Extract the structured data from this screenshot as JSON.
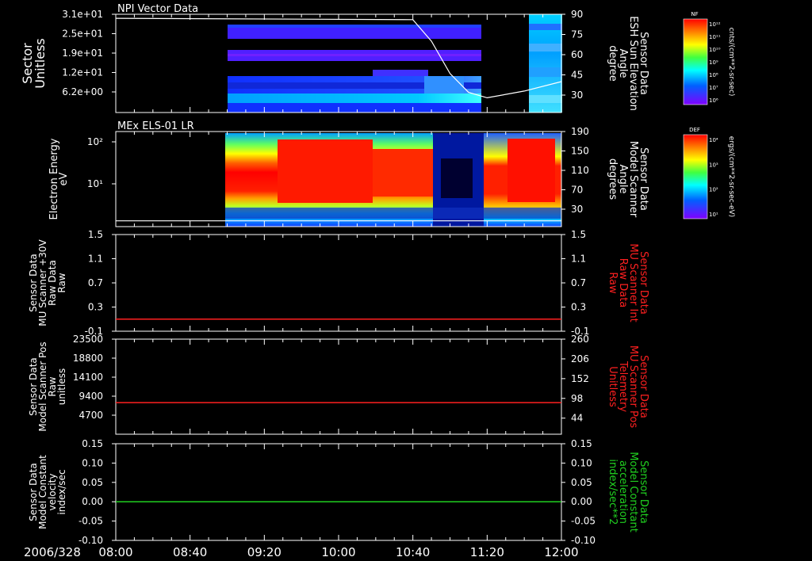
{
  "date_label": "2006/328",
  "time_ticks": [
    "08:00",
    "08:40",
    "09:20",
    "10:00",
    "10:40",
    "11:20",
    "12:00"
  ],
  "colors": {
    "axis": "#ffffff",
    "red_trace": "#ff2020",
    "green_trace": "#20d020"
  },
  "colorbars": [
    {
      "tag": "NF",
      "top_label": "10¹²",
      "bottom_label": "10⁶",
      "units": "cnts/(cm**2-sr-sec)",
      "tick_labels": [
        "10¹²",
        "10¹¹",
        "10¹⁰",
        "10⁹",
        "10⁸",
        "10⁷",
        "10⁶"
      ]
    },
    {
      "tag": "DEF",
      "top_label": "10⁴",
      "bottom_label": "10¹",
      "units": "ergs/(cm**2-sr-sec-eV)",
      "tick_labels": [
        "10⁴",
        "10³",
        "10²",
        "10¹"
      ]
    }
  ],
  "chart_data": [
    {
      "type": "heatmap",
      "title": "NPI Vector Data",
      "ylabel": [
        "Sector",
        "Unitless"
      ],
      "y_ticks": [
        "3.1e+01",
        "2.5e+01",
        "1.9e+01",
        "1.2e+01",
        "6.2e+00"
      ],
      "right_ylabel": [
        "Sensor Data",
        "ESH Sun Elevation",
        "Angle",
        "degree"
      ],
      "right_ticks": [
        "90",
        "75",
        "60",
        "45",
        "30"
      ],
      "overlay_line": {
        "name": "ESH Sun Elevation Angle",
        "color": "#ffffff",
        "points": [
          [
            "08:00",
            87
          ],
          [
            "10:40",
            86
          ],
          [
            "10:50",
            70
          ],
          [
            "11:00",
            46
          ],
          [
            "11:10",
            32
          ],
          [
            "11:20",
            28
          ],
          [
            "11:40",
            33
          ],
          [
            "12:00",
            40
          ]
        ]
      }
    },
    {
      "type": "heatmap",
      "title": "MEx ELS-01 LR",
      "ylabel": [
        "Electron Energy",
        "eV"
      ],
      "y_ticks": [
        "10²",
        "10¹"
      ],
      "right_ylabel": [
        "Sensor Data",
        "Model Scanner",
        "Angle",
        "degrees"
      ],
      "right_ticks": [
        "190",
        "150",
        "110",
        "70",
        "30"
      ],
      "overlay_line": {
        "name": "Model Scanner Angle",
        "color": "#ffffff",
        "value": 6
      }
    },
    {
      "type": "line",
      "ylabel": [
        "Sensor Data",
        "MU Scanner +30V",
        "Raw Data",
        "Raw"
      ],
      "ylim": [
        -0.1,
        1.5
      ],
      "y_ticks": [
        "1.5",
        "1.1",
        "0.7",
        "0.3",
        "-0.1"
      ],
      "right_ylabel": [
        "Sensor Data",
        "MU Scanner Int",
        "Raw Data",
        "Raw"
      ],
      "right_ylim": [
        -0.1,
        1.5
      ],
      "right_ticks": [
        "1.5",
        "1.1",
        "0.7",
        "0.3",
        "-0.1"
      ],
      "series": [
        {
          "color": "#ff2020",
          "values": [
            [
              "08:00",
              0.1
            ],
            [
              "12:00",
              0.1
            ]
          ]
        }
      ]
    },
    {
      "type": "line",
      "ylabel": [
        "Sensor Data",
        "Model Scanner Pos",
        "Raw",
        "unitless"
      ],
      "ylim": [
        0,
        23500
      ],
      "y_ticks": [
        "23500",
        "18800",
        "14100",
        "9400",
        "4700"
      ],
      "right_ylabel": [
        "Sensor Data",
        "MU Scanner Pos",
        "Telemetry",
        "Unitless"
      ],
      "right_ylim": [
        0,
        260
      ],
      "right_ticks": [
        "260",
        "206",
        "152",
        "98",
        "44"
      ],
      "series": [
        {
          "color": "#ff2020",
          "values": [
            [
              "08:00",
              7800
            ],
            [
              "12:00",
              7800
            ]
          ]
        }
      ]
    },
    {
      "type": "line",
      "ylabel": [
        "Sensor Data",
        "Model Constant",
        "velocity",
        "index/sec"
      ],
      "ylim": [
        -0.1,
        0.15
      ],
      "y_ticks": [
        "0.15",
        "0.10",
        "0.05",
        "0.00",
        "-0.05",
        "-0.10"
      ],
      "right_ylabel": [
        "Sensor Data",
        "Model Constant",
        "acceleration",
        "index/sec**2"
      ],
      "right_ylim": [
        -0.1,
        0.15
      ],
      "right_ticks": [
        "0.15",
        "0.10",
        "0.05",
        "0.00",
        "-0.05",
        "-0.10"
      ],
      "series": [
        {
          "color": "#20d020",
          "values": [
            [
              "08:00",
              0.0
            ],
            [
              "12:00",
              0.0
            ]
          ]
        }
      ]
    }
  ]
}
